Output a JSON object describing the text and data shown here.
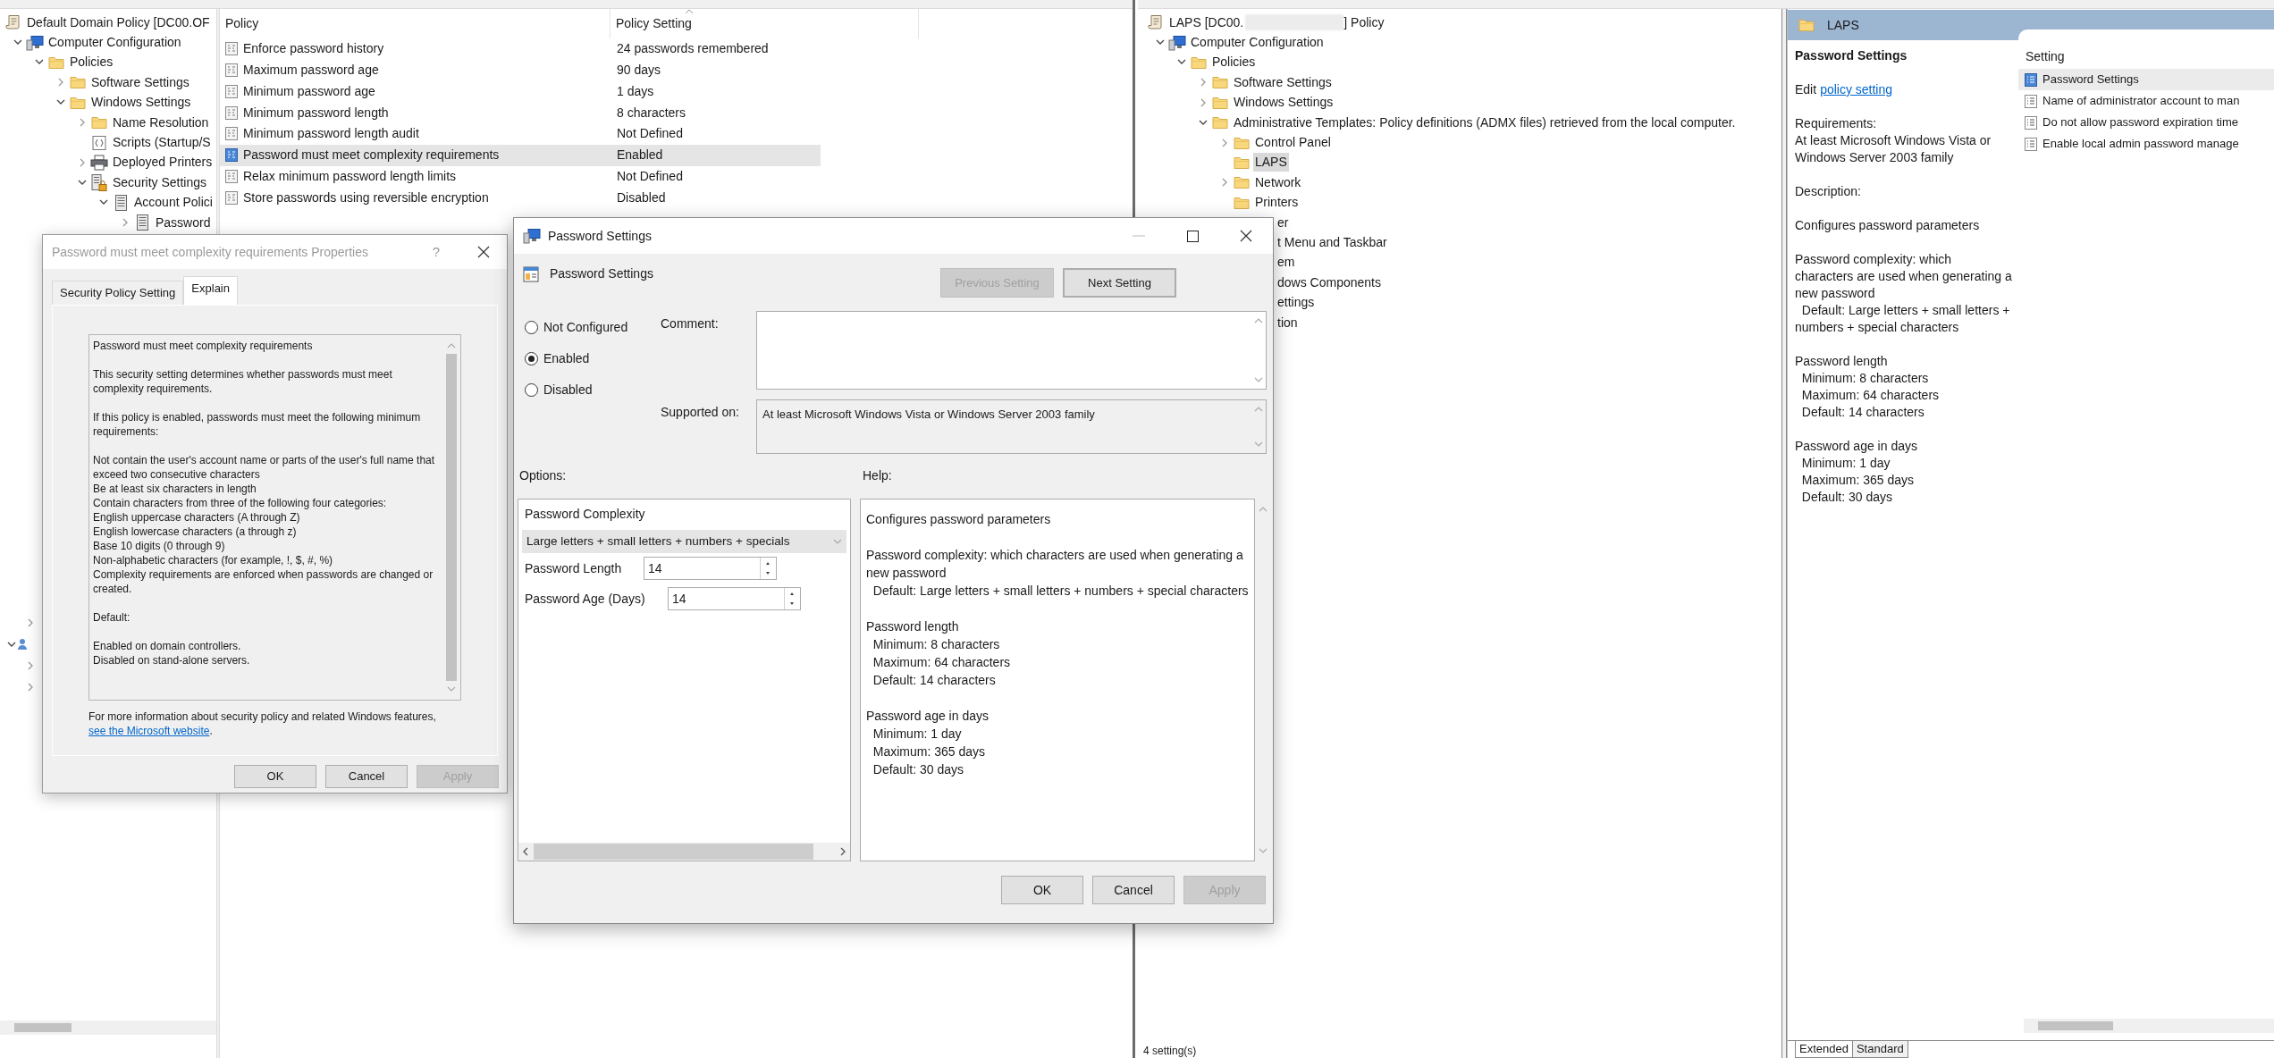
{
  "left_window": {
    "tree": [
      {
        "text": "Default Domain Policy [DC00.OF",
        "kind": "policy",
        "children": [
          {
            "text": "Computer Configuration",
            "kind": "computer",
            "expanded": true,
            "children": [
              {
                "text": "Policies",
                "kind": "folder",
                "expanded": true,
                "children": [
                  {
                    "text": "Software Settings",
                    "kind": "folder",
                    "expanded": false
                  },
                  {
                    "text": "Windows Settings",
                    "kind": "folder",
                    "expanded": true,
                    "children": [
                      {
                        "text": "Name Resolution",
                        "kind": "folder",
                        "expanded": false
                      },
                      {
                        "text": "Scripts (Startup/S",
                        "kind": "scripts"
                      },
                      {
                        "text": "Deployed Printers",
                        "kind": "printer",
                        "expanded": false
                      },
                      {
                        "text": "Security Settings",
                        "kind": "security",
                        "expanded": true,
                        "children": [
                          {
                            "text": "Account Polici",
                            "kind": "account",
                            "expanded": true,
                            "children": [
                              {
                                "text": "Password",
                                "kind": "account",
                                "expanded": false
                              }
                            ]
                          }
                        ]
                      }
                    ]
                  }
                ]
              }
            ]
          }
        ]
      }
    ],
    "policy_table": {
      "columns": [
        "Policy",
        "Policy Setting"
      ],
      "rows": [
        {
          "policy": "Enforce password history",
          "setting": "24 passwords remembered",
          "selected": false
        },
        {
          "policy": "Maximum password age",
          "setting": "90 days",
          "selected": false
        },
        {
          "policy": "Minimum password age",
          "setting": "1 days",
          "selected": false
        },
        {
          "policy": "Minimum password length",
          "setting": "8 characters",
          "selected": false
        },
        {
          "policy": "Minimum password length audit",
          "setting": "Not Defined",
          "selected": false
        },
        {
          "policy": "Password must meet complexity requirements",
          "setting": "Enabled",
          "selected": true
        },
        {
          "policy": "Relax minimum password length limits",
          "setting": "Not Defined",
          "selected": false
        },
        {
          "policy": "Store passwords using reversible encryption",
          "setting": "Disabled",
          "selected": false
        }
      ]
    }
  },
  "right_window": {
    "tree": [
      {
        "text": "LAPS [DC00.",
        "text_after": "] Policy",
        "redacted": true,
        "kind": "policy",
        "children": [
          {
            "text": "Computer Configuration",
            "kind": "computer",
            "expanded": true,
            "children": [
              {
                "text": "Policies",
                "kind": "folder",
                "expanded": true,
                "children": [
                  {
                    "text": "Software Settings",
                    "kind": "folder",
                    "expanded": false
                  },
                  {
                    "text": "Windows Settings",
                    "kind": "folder",
                    "expanded": false
                  },
                  {
                    "text": "Administrative Templates: Policy definitions (ADMX files) retrieved from the local computer.",
                    "kind": "folder",
                    "expanded": true,
                    "children": [
                      {
                        "text": "Control Panel",
                        "kind": "folder",
                        "expanded": false,
                        "selected": false
                      },
                      {
                        "text": "LAPS",
                        "kind": "folder",
                        "selected": true
                      },
                      {
                        "text": "Network",
                        "kind": "folder",
                        "expanded": false,
                        "selected": false
                      },
                      {
                        "text": "Printers",
                        "kind": "folder",
                        "selected": false
                      },
                      {
                        "text": "er",
                        "selected": false
                      },
                      {
                        "text": "t Menu and Taskbar",
                        "selected": false
                      },
                      {
                        "text": "em",
                        "selected": false
                      },
                      {
                        "text": "dows Components",
                        "selected": false
                      },
                      {
                        "text": "ettings",
                        "selected": false
                      },
                      {
                        "text": "tion",
                        "selected": false
                      }
                    ]
                  }
                ]
              }
            ]
          }
        ]
      }
    ],
    "extended_view": {
      "header": "LAPS",
      "title": "Password Settings",
      "edit_prefix": "Edit",
      "edit_link": "policy setting",
      "requirements_label": "Requirements:",
      "requirements": "At least Microsoft Windows Vista or Windows Server 2003 family",
      "description_label": "Description:",
      "description": [
        [
          "Configures password parameters"
        ],
        [
          "Password complexity: which characters are used when generating a new password",
          "  Default: Large letters + small letters + numbers + special characters"
        ],
        [
          "Password length",
          "  Minimum: 8 characters",
          "  Maximum: 64 characters",
          "  Default: 14 characters"
        ],
        [
          "Password age in days",
          "  Minimum: 1 day",
          "  Maximum: 365 days",
          "  Default: 30 days"
        ]
      ],
      "settings_column": "Setting",
      "settings": [
        {
          "text": "Password Settings",
          "selected": true
        },
        {
          "text": "Name of administrator account to man",
          "selected": false
        },
        {
          "text": "Do not allow password expiration time",
          "selected": false
        },
        {
          "text": "Enable local admin password manage",
          "selected": false
        }
      ]
    },
    "tabs": [
      {
        "label": "Extended",
        "selected": true
      },
      {
        "label": "Standard",
        "selected": false
      }
    ],
    "status_bar": "4 setting(s)"
  },
  "properties_dialog": {
    "title": "Password must meet complexity requirements Properties",
    "help_glyph": "?",
    "tabs": [
      {
        "label": "Security Policy Setting",
        "selected": false
      },
      {
        "label": "Explain",
        "selected": true
      }
    ],
    "explain": [
      [
        "Password must meet complexity requirements"
      ],
      [
        "This security setting determines whether passwords must meet complexity requirements."
      ],
      [
        "If this policy is enabled, passwords must meet the following minimum requirements:"
      ],
      [
        "Not contain the user's account name or parts of the user's full name that exceed two consecutive characters",
        "Be at least six characters in length",
        "Contain characters from three of the following four categories:",
        "English uppercase characters (A through Z)",
        "English lowercase characters (a through z)",
        "Base 10 digits (0 through 9)",
        "Non-alphabetic characters (for example, !, $, #, %)",
        "Complexity requirements are enforced when passwords are changed or created."
      ],
      [
        "Default:"
      ],
      [
        "Enabled on domain controllers.",
        "Disabled on stand-alone servers."
      ]
    ],
    "more_info": {
      "before": "For more information about security policy and related Windows features,",
      "link": "see the Microsoft website",
      "after": "."
    },
    "buttons": [
      {
        "label": "OK",
        "disabled": false
      },
      {
        "label": "Cancel",
        "disabled": false
      },
      {
        "label": "Apply",
        "disabled": true
      }
    ]
  },
  "settings_dialog": {
    "title": "Password Settings",
    "heading": "Password Settings",
    "nav_buttons": [
      {
        "label": "Previous Setting",
        "disabled": true,
        "focused": false
      },
      {
        "label": "Next Setting",
        "disabled": false,
        "focused": true
      }
    ],
    "radios": [
      {
        "label": "Not Configured",
        "selected": false
      },
      {
        "label": "Enabled",
        "selected": true
      },
      {
        "label": "Disabled",
        "selected": false
      }
    ],
    "comment_label": "Comment:",
    "supported_label": "Supported on:",
    "supported_on": "At least Microsoft Windows Vista or Windows Server 2003 family",
    "options_label": "Options:",
    "help_label": "Help:",
    "options": {
      "complexity_label": "Password Complexity",
      "complexity_value": "Large letters + small letters + numbers + specials",
      "spinners": [
        {
          "label": "Password Length",
          "value": "14"
        },
        {
          "label": "Password Age (Days)",
          "value": "14"
        }
      ]
    },
    "help": [
      [
        "Configures password parameters"
      ],
      [
        "Password complexity: which characters are used when generating a new password",
        "  Default: Large letters + small letters + numbers + special characters"
      ],
      [
        "Password length",
        "  Minimum: 8 characters",
        "  Maximum: 64 characters",
        "  Default: 14 characters"
      ],
      [
        "Password age in days",
        "  Minimum: 1 day",
        "  Maximum: 365 days",
        "  Default: 30 days"
      ]
    ],
    "buttons": [
      {
        "label": "OK",
        "disabled": false
      },
      {
        "label": "Cancel",
        "disabled": false
      },
      {
        "label": "Apply",
        "disabled": true
      }
    ]
  }
}
